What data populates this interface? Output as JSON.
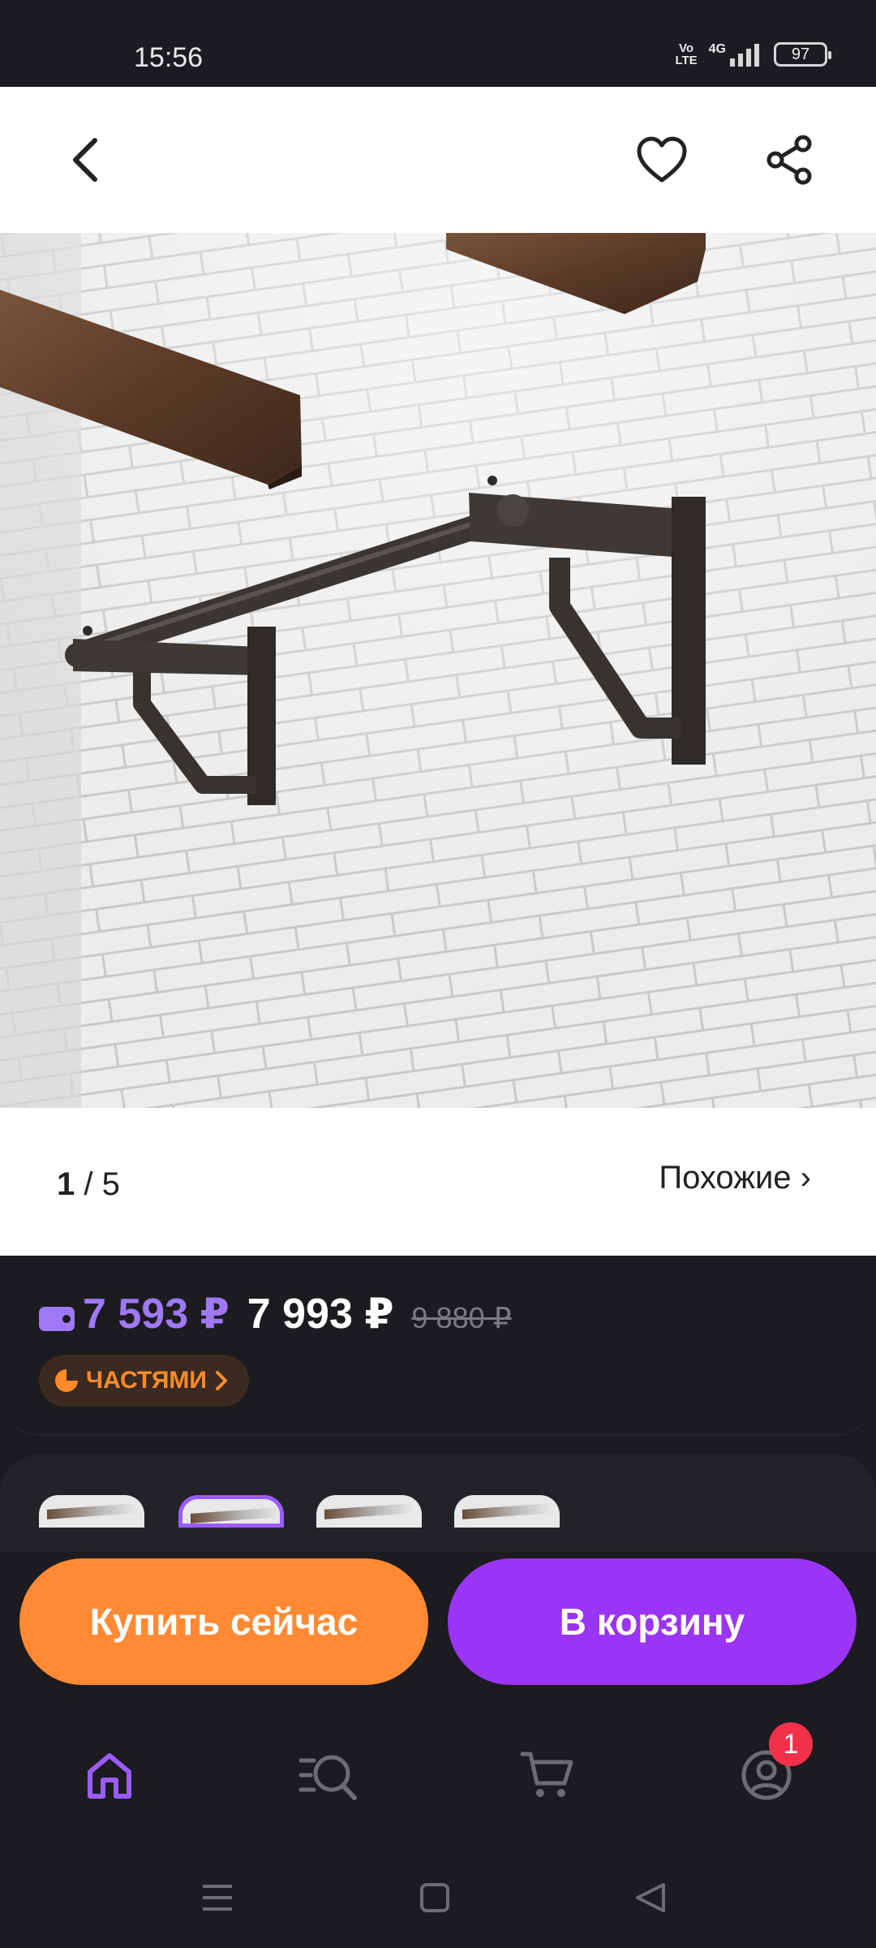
{
  "status_bar": {
    "time": "15:56",
    "network": "4G",
    "volte": "Vo LTE",
    "battery": "97"
  },
  "gallery": {
    "current": "1",
    "separator": "/",
    "total": "5",
    "similar_label": "Похожие ›"
  },
  "pricing": {
    "wallet_price": "7 593 ₽",
    "price": "7 993 ₽",
    "old_price": "9 880 ₽",
    "installment_label": "ЧАСТЯМИ",
    "wallet_color": "#9f78f5",
    "installment_color": "#ff8a2a"
  },
  "actions": {
    "buy_now": "Купить сейчас",
    "add_to_cart": "В корзину",
    "buy_color": "#ff8a33",
    "cart_color": "#9b35f5"
  },
  "tabs": [
    {
      "icon": "home-icon",
      "active": true
    },
    {
      "icon": "catalog-search-icon",
      "active": false
    },
    {
      "icon": "cart-icon",
      "active": false
    },
    {
      "icon": "profile-icon",
      "active": false
    }
  ],
  "profile_badge": "1"
}
